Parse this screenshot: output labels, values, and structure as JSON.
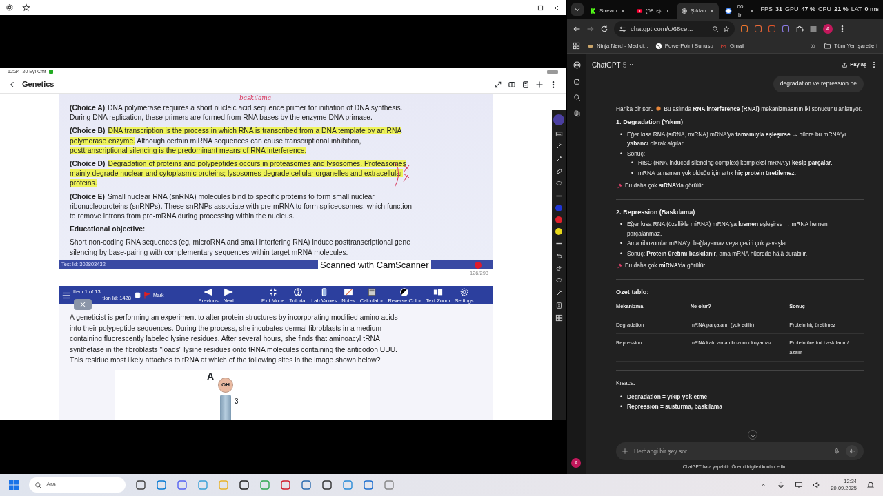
{
  "left_window": {
    "tablet": {
      "status": {
        "time": "12:34",
        "date": "20 Eyl Cmt"
      },
      "title": "Genetics"
    }
  },
  "document": {
    "annotation": "baskılama",
    "choices": [
      {
        "label": "(Choice A)",
        "segments": [
          {
            "text": "DNA polymerase requires a short nucleic acid sequence primer for initiation of DNA synthesis. During DNA replication, these primers are formed from RNA bases by the enzyme DNA primase.",
            "highlighted": false
          }
        ]
      },
      {
        "label": "(Choice B)",
        "segments": [
          {
            "text": "DNA transcription is the process in which RNA is transcribed from a DNA template by an RNA polymerase enzyme.",
            "highlighted": true
          },
          {
            "text": "  Although certain miRNA sequences can cause transcriptional inhibition, ",
            "highlighted": false
          },
          {
            "text": "posttranscriptional silencing is the predominant means of RNA interference.",
            "highlighted": true
          }
        ]
      },
      {
        "label": "(Choice D)",
        "segments": [
          {
            "text": "Degradation of proteins and polypeptides occurs in proteasomes and lysosomes.  Proteasomes mainly degrade nuclear and cytoplasmic proteins; lysosomes degrade cellular organelles and extracellular proteins.",
            "highlighted": true
          }
        ]
      },
      {
        "label": "(Choice E)",
        "segments": [
          {
            "text": "Small nuclear RNA (snRNA) molecules bind to specific proteins to form small nuclear ribonucleoproteins (snRNPs).  These snRNPs associate with pre-mRNA to form spliceosomes, which function to remove introns from pre-mRNA during processing within the nucleus.",
            "highlighted": false
          }
        ]
      }
    ],
    "objective_title": "Educational objective:",
    "objective": "Short non-coding RNA sequences (eg, microRNA and small interfering RNA) induce posttranscriptional gene silencing by base-pairing with complementary sequences within target mRNA molecules.",
    "test_id": "Test Id: 302803432",
    "scanner_label": "Scanned with CamScanner",
    "page_number": "126/298"
  },
  "question_page": {
    "item": "Item 1 of 13",
    "question_id": "tion Id: 1428",
    "mark": {
      "label": "Mark",
      "checked": false
    },
    "tools": [
      {
        "label": "Previous",
        "kind": "previous"
      },
      {
        "label": "Next",
        "kind": "next"
      },
      {
        "label": "Exit Mode",
        "kind": "exit"
      },
      {
        "label": "Tutorial",
        "kind": "help"
      },
      {
        "label": "Lab Values",
        "kind": "flask"
      },
      {
        "label": "Notes",
        "kind": "notes"
      },
      {
        "label": "Calculator",
        "kind": "calculator"
      },
      {
        "label": "Reverse Color",
        "kind": "contrast"
      },
      {
        "label": "Text Zoom",
        "kind": "textzoom"
      },
      {
        "label": "Settings",
        "kind": "settings"
      }
    ],
    "question": "A geneticist is performing an experiment to alter protein structures by incorporating modified amino acids into their polypeptide sequences.  During the process, she incubates dermal fibroblasts in a medium containing fluorescently labeled lysine residues.  After several hours, she finds that aminoacyl tRNA synthetase in the fibroblasts \"loads\" lysine residues onto tRNA molecules containing the anticodon UUU.  This residue most likely attaches to tRNA at which of the following sites in the image shown below?",
    "figure": {
      "site_label": "A",
      "end_group": "OH",
      "end_label": "3'"
    }
  },
  "pen_toolbar": {
    "colors": [
      {
        "color": "#1f35d6"
      },
      {
        "color": "#e0202a"
      },
      {
        "color": "#e8d81a"
      }
    ]
  },
  "browser": {
    "tabs": [
      {
        "title": "Stream",
        "kind": "k",
        "selected": false,
        "audio": false
      },
      {
        "title": "(68",
        "kind": "video",
        "selected": false,
        "audio": true
      },
      {
        "title": "Şıklan",
        "kind": "chat",
        "selected": true,
        "audio": false
      },
      {
        "title": "00 bi",
        "kind": "google",
        "selected": false,
        "audio": false
      }
    ],
    "perf": [
      {
        "label": "FPS",
        "value": "31"
      },
      {
        "label": "GPU",
        "value": "47",
        "unit": "%"
      },
      {
        "label": "CPU",
        "value": "21",
        "unit": "%"
      },
      {
        "label": "LAT",
        "value": "0",
        "unit": "ms"
      }
    ],
    "address": "chatgpt.com/c/68ce...",
    "profile": "A",
    "bookmarks": [
      {
        "title": "Ninja Nerd - Medici...",
        "kind": "site"
      },
      {
        "title": "PowerPoint Sunusu",
        "kind": "globe"
      },
      {
        "title": "Gmail",
        "kind": "mail"
      }
    ],
    "all_bookmarks": "Tüm Yer İşaretleri"
  },
  "chat": {
    "model": "ChatGPT",
    "version": "5",
    "share": "Paylaş",
    "user_message": "degradation ve repression ne",
    "avatar": "A",
    "blocks": [
      {
        "kind": "paragraph",
        "lead": "Harika bir soru",
        "text": "Bu aslında **RNA interference (RNAi)** mekanizmasının iki sonucunu anlatıyor."
      },
      {
        "kind": "heading",
        "text": "1. Degradation (Yıkım)"
      },
      {
        "kind": "list",
        "strong": false,
        "bullet": "•",
        "items": [
          {
            "text": "Eğer kısa RNA (siRNA, miRNA) mRNA'ya **tamamıyla eşleşirse** → hücre bu mRNA'yı **yabancı** olarak algılar."
          },
          {
            "text": "Sonuç:",
            "children": [
              {
                "text": "RISC (RNA-induced silencing complex) kompleksi mRNA'yı **kesip parçalar**."
              },
              {
                "text": "mRNA tamamen yok olduğu için artık **hiç protein üretilemez.**"
              }
            ]
          }
        ]
      },
      {
        "kind": "note",
        "text": "Bu daha çok **siRNA**'da görülür."
      },
      {
        "kind": "divider"
      },
      {
        "kind": "heading",
        "text": "2. Repression (Baskılama)"
      },
      {
        "kind": "list",
        "strong": false,
        "bullet": "•",
        "items": [
          {
            "text": "Eğer kısa RNA (özellikle miRNA) mRNA'ya **kısmen** eşleşirse → mRNA hemen parçalanmaz."
          },
          {
            "text": "Ama ribozomlar mRNA'yı bağlayamaz veya çeviri çok yavaşlar."
          },
          {
            "text": "Sonuç: **Protein üretimi baskılanır**, ama mRNA hücrede hâlâ durabilir."
          }
        ]
      },
      {
        "kind": "note",
        "text": "Bu daha çok **miRNA**'da görülür."
      },
      {
        "kind": "divider"
      },
      {
        "kind": "heading",
        "text": "Özet tablo:"
      },
      {
        "kind": "table",
        "columns": [
          "Mekanizma",
          "Ne olur?",
          "Sonuç"
        ],
        "rows": [
          [
            "Degradation",
            "mRNA parçalanır (yok edilir)",
            "Protein hiç üretilmez"
          ],
          [
            "Repression",
            "mRNA kalır ama ribozom okuyamaz",
            "Protein üretimi baskılanır / azalır"
          ]
        ]
      },
      {
        "kind": "divider"
      },
      {
        "kind": "paragraph",
        "text": "Kısaca:"
      },
      {
        "kind": "list",
        "strong": true,
        "bullet": "•",
        "items": [
          {
            "text": "Degradation = yıkıp yok etme"
          },
          {
            "text": "Repression = susturma, baskılama"
          }
        ]
      }
    ],
    "input_placeholder": "Herhangi bir şey sor",
    "disclaimer": "ChatGPT hata yapabilir. Önemli bilgileri kontrol edin."
  },
  "taskbar": {
    "search_placeholder": "Ara",
    "time": "12:34",
    "date": "20.09.2025"
  }
}
